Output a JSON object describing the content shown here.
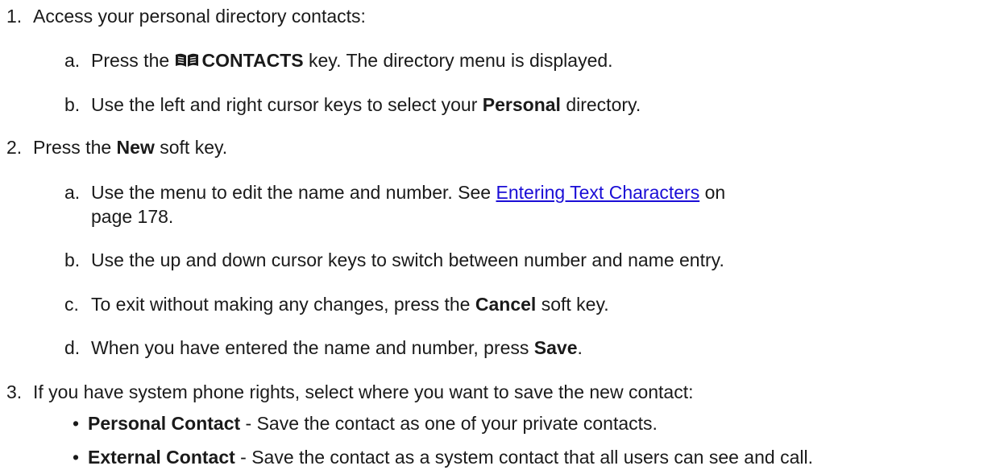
{
  "steps": [
    {
      "number": "1.",
      "text": "Access your personal directory contacts:",
      "substeps": [
        {
          "letter": "a.",
          "pre": "Press the",
          "icon": "book-icon",
          "bold": "CONTACTS",
          "post": "key. The directory menu is displayed."
        },
        {
          "letter": "b.",
          "pre": "Use the left and right cursor keys to select your",
          "bold": "Personal",
          "post": "directory."
        }
      ]
    },
    {
      "number": "2.",
      "pre": "Press the",
      "bold": "New",
      "post": "soft key.",
      "substeps": [
        {
          "letter": "a.",
          "pre": "Use the menu to edit the name and number. See",
          "link": "Entering Text Characters",
          "post": "on",
          "cont": "page 178."
        },
        {
          "letter": "b.",
          "text": "Use the up and down cursor keys to switch between number and name entry."
        },
        {
          "letter": "c.",
          "pre": "To exit without making any changes, press the",
          "bold": "Cancel",
          "post": "soft key."
        },
        {
          "letter": "d.",
          "pre": "When you have entered the name and number, press",
          "bold": "Save",
          "post": "."
        }
      ]
    },
    {
      "number": "3.",
      "text": "If you have system phone rights, select where you want to save the new contact:",
      "bullets": [
        {
          "marker": "•",
          "bold": "Personal Contact",
          "text": " - Save the contact as one of your private contacts."
        },
        {
          "marker": "•",
          "bold": "External Contact",
          "text": " - Save the contact as a system contact that all users can see and call."
        }
      ]
    }
  ]
}
